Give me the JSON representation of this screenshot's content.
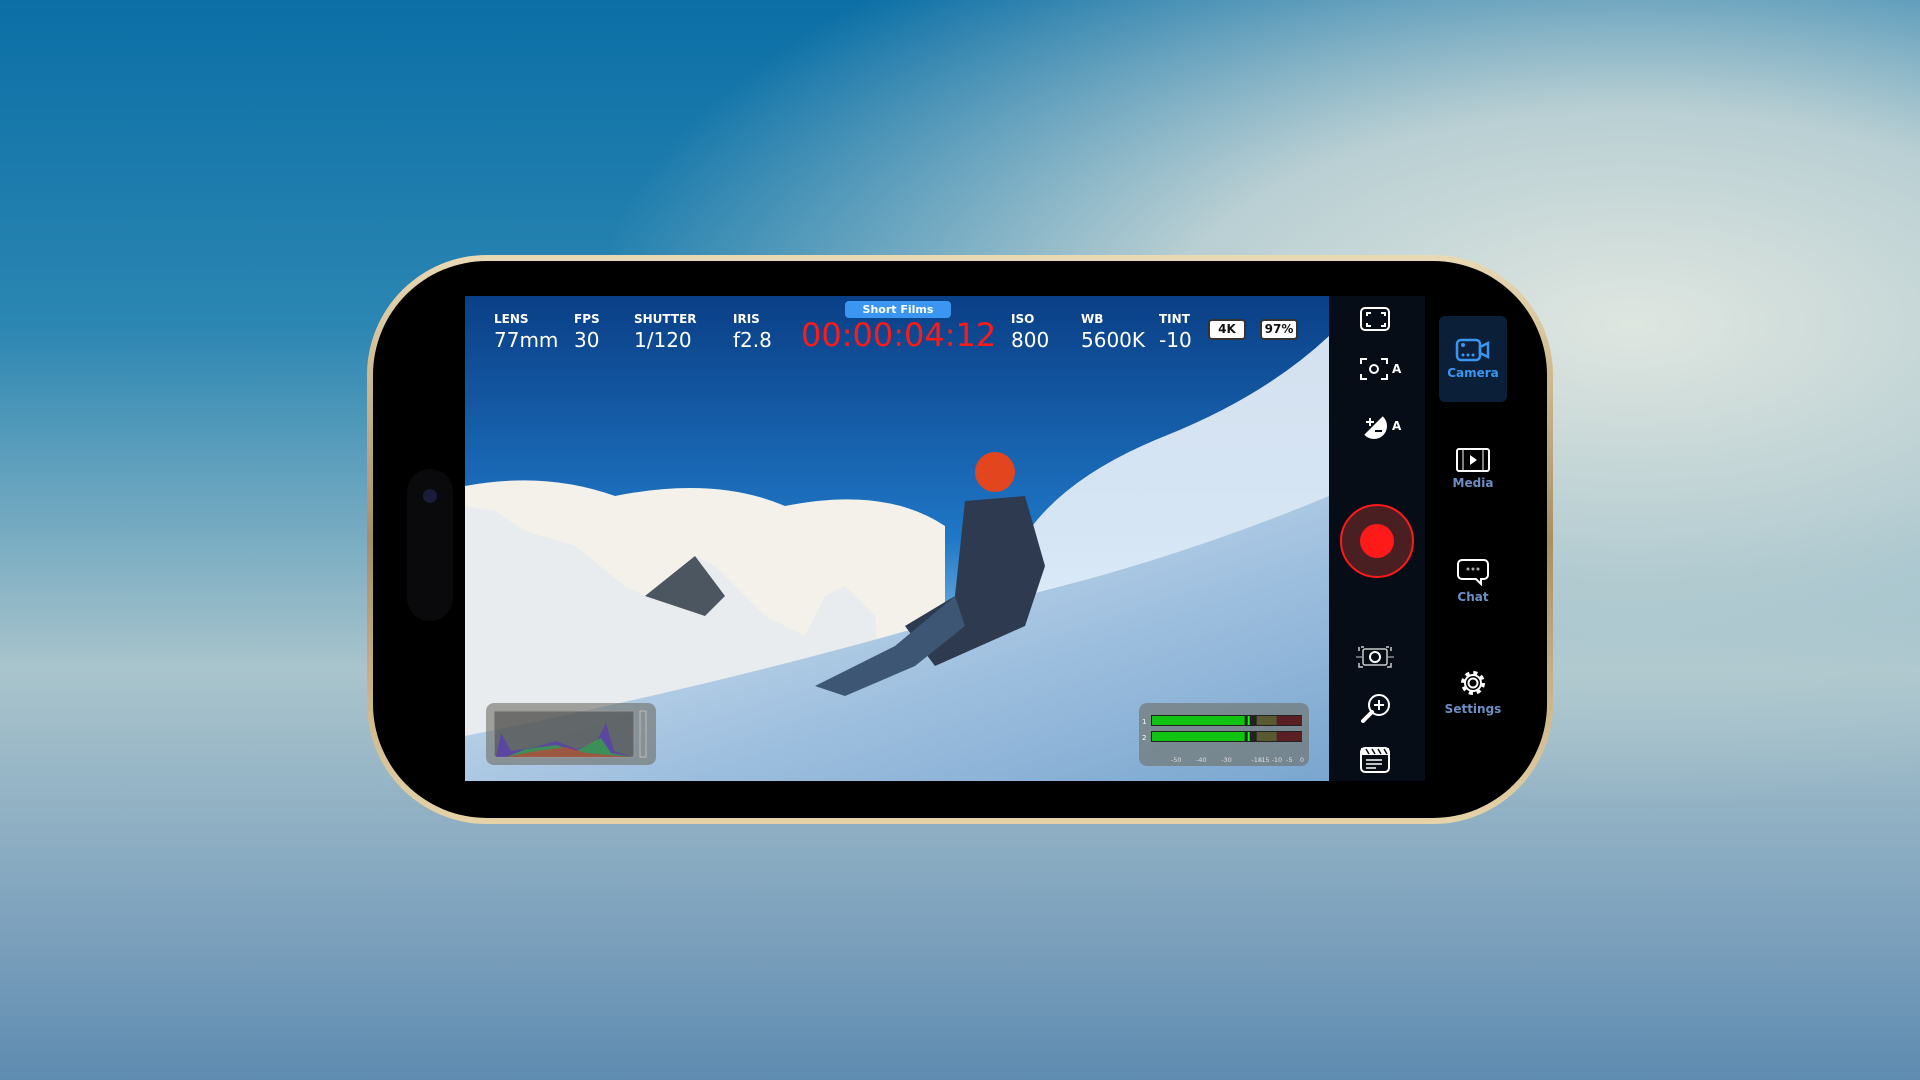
{
  "hud": {
    "lens": {
      "label": "LENS",
      "value": "77mm"
    },
    "fps": {
      "label": "FPS",
      "value": "30"
    },
    "shutter": {
      "label": "SHUTTER",
      "value": "1/120"
    },
    "iris": {
      "label": "IRIS",
      "value": "f2.8"
    },
    "project": "Short Films",
    "timecode": "00:00:04:12",
    "iso": {
      "label": "ISO",
      "value": "800"
    },
    "wb": {
      "label": "WB",
      "value": "5600K"
    },
    "tint": {
      "label": "TINT",
      "value": "-10"
    },
    "resolution": "4K",
    "battery": "97%"
  },
  "audio": {
    "channels": [
      "1",
      "2"
    ],
    "scale": [
      "-50",
      "-40",
      "-30",
      "-18",
      "-15",
      "-10",
      "-5",
      "0"
    ],
    "levels_db": [
      -20,
      -20
    ]
  },
  "controls": [
    "fullscreen-icon",
    "auto-focus-icon",
    "auto-exposure-icon",
    "record-button",
    "stabilization-icon",
    "zoom-icon",
    "clapper-icon"
  ],
  "controls_auto": "A",
  "nav": [
    {
      "label": "Camera",
      "icon": "video-camera-icon",
      "active": true
    },
    {
      "label": "Media",
      "icon": "film-icon"
    },
    {
      "label": "Chat",
      "icon": "chat-bubble-icon"
    },
    {
      "label": "Settings",
      "icon": "gear-icon"
    }
  ],
  "colors": {
    "record": "#ff1a1a",
    "accent": "#3a96f0",
    "timecode": "#ff1a1a"
  }
}
